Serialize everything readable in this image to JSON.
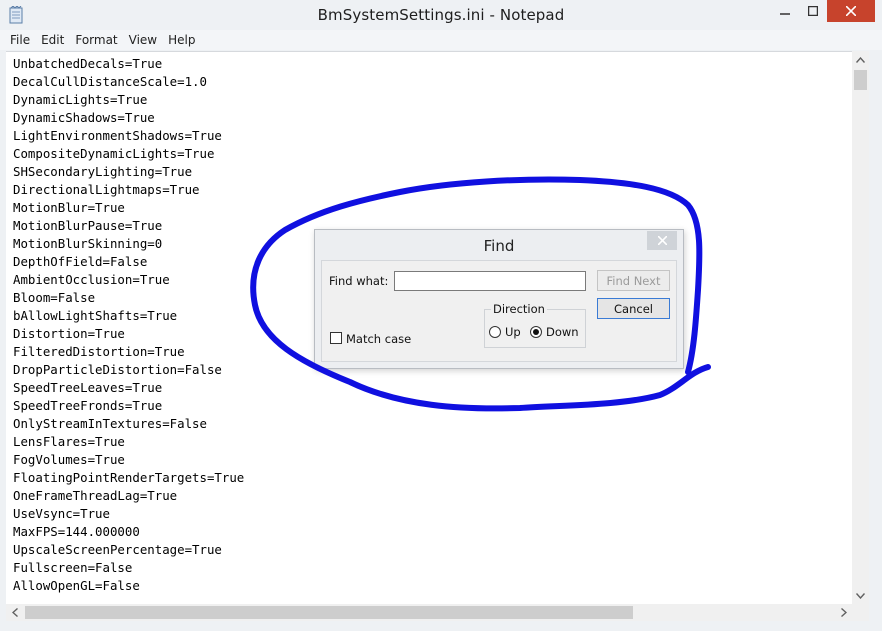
{
  "window": {
    "title": "BmSystemSettings.ini - Notepad",
    "close_color": "#c7432c"
  },
  "menu": {
    "items": [
      "File",
      "Edit",
      "Format",
      "View",
      "Help"
    ]
  },
  "editor": {
    "lines": [
      "UnbatchedDecals=True",
      "DecalCullDistanceScale=1.0",
      "DynamicLights=True",
      "DynamicShadows=True",
      "LightEnvironmentShadows=True",
      "CompositeDynamicLights=True",
      "SHSecondaryLighting=True",
      "DirectionalLightmaps=True",
      "MotionBlur=True",
      "MotionBlurPause=True",
      "MotionBlurSkinning=0",
      "DepthOfField=False",
      "AmbientOcclusion=True",
      "Bloom=False",
      "bAllowLightShafts=True",
      "Distortion=True",
      "FilteredDistortion=True",
      "DropParticleDistortion=False",
      "SpeedTreeLeaves=True",
      "SpeedTreeFronds=True",
      "OnlyStreamInTextures=False",
      "LensFlares=True",
      "FogVolumes=True",
      "FloatingPointRenderTargets=True",
      "OneFrameThreadLag=True",
      "UseVsync=True",
      "MaxFPS=144.000000",
      "UpscaleScreenPercentage=True",
      "Fullscreen=False",
      "AllowOpenGL=False"
    ]
  },
  "find_dialog": {
    "title": "Find",
    "find_what_label": "Find what:",
    "find_what_value": "",
    "find_next_label": "Find Next",
    "cancel_label": "Cancel",
    "direction_label": "Direction",
    "up_label": "Up",
    "down_label": "Down",
    "direction_selected": "Down",
    "match_case_label": "Match case",
    "match_case_checked": false
  },
  "annotation": {
    "color": "#1010e0",
    "shape": "hand-drawn circle around Find dialog"
  }
}
